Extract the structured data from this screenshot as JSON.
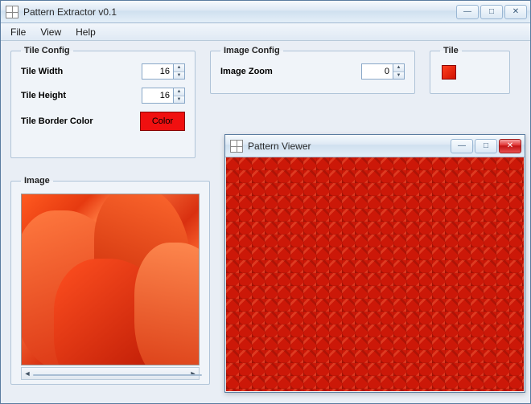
{
  "app": {
    "title": "Pattern Extractor v0.1",
    "icon": "pattern-extractor-icon"
  },
  "menu": {
    "file": "File",
    "view": "View",
    "help": "Help"
  },
  "groups": {
    "tile_config": "Tile Config",
    "image_config": "Image Config",
    "tile": "Tile",
    "image": "Image"
  },
  "tile_config": {
    "width_label": "Tile Width",
    "width_value": "16",
    "height_label": "Tile Height",
    "height_value": "16",
    "border_label": "Tile Border Color",
    "color_button": "Color",
    "border_color": "#f01010"
  },
  "image_config": {
    "zoom_label": "Image Zoom",
    "zoom_value": "0"
  },
  "viewer": {
    "title": "Pattern Viewer",
    "icon": "pattern-extractor-icon"
  },
  "window_controls": {
    "minimize": "—",
    "maximize": "□",
    "close": "✕"
  }
}
